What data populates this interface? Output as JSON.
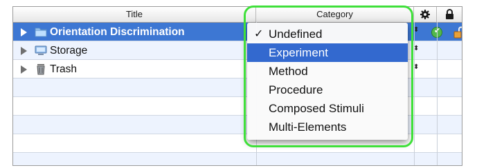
{
  "table": {
    "columns": [
      "Title",
      "Category"
    ],
    "header_icons": [
      "gear-icon",
      "lock-icon"
    ],
    "rows": [
      {
        "title": "Orientation Discrimination",
        "icon": "folder-icon",
        "selected": true
      },
      {
        "title": "Storage",
        "icon": "storage-icon",
        "selected": false
      },
      {
        "title": "Trash",
        "icon": "trash-icon",
        "selected": false
      }
    ]
  },
  "category_menu": {
    "items": [
      "Undefined",
      "Experiment",
      "Method",
      "Procedure",
      "Composed Stimuli",
      "Multi-Elements"
    ],
    "checked": "Undefined",
    "highlighted": "Experiment",
    "check_mark": "✓"
  },
  "colors": {
    "selection": "#3d77d3",
    "menu_highlight": "#3369cf",
    "annotation_frame": "#3fe03a",
    "alt_row": "#edf3fe"
  }
}
